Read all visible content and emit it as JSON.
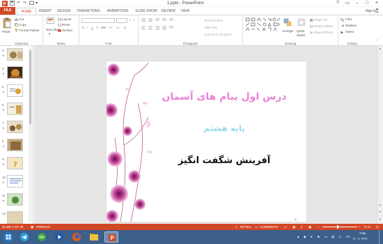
{
  "window": {
    "title": "1.pptx - PowerPoint",
    "controls": [
      "?",
      "▭",
      "–",
      "□",
      "×"
    ]
  },
  "ribbon_tabs": [
    "FILE",
    "HOME",
    "INSERT",
    "DESIGN",
    "TRANSITIONS",
    "ANIMATIONS",
    "SLIDE SHOW",
    "REVIEW",
    "VIEW"
  ],
  "active_tab": "HOME",
  "signin": "Sign in",
  "ribbon": {
    "clipboard": {
      "paste": "Paste",
      "cut": "Cut",
      "copy": "Copy",
      "format_painter": "Format Painter",
      "label": "Clipboard"
    },
    "slides": {
      "new_slide": "New Slide",
      "new_slide_line2": "▾",
      "layout": "Layout",
      "reset": "Reset",
      "section": "Section",
      "label": "Slides"
    },
    "font": {
      "label": "Font"
    },
    "paragraph": {
      "text_direction": "Text Direction",
      "align_text": "Align Text",
      "convert_smartart": "Convert to SmartArt",
      "label": "Paragraph"
    },
    "drawing": {
      "arrange": "Arrange",
      "quick_styles": "Quick",
      "quick_styles_line2": "Styles",
      "shape_fill": "Shape Fill",
      "shape_outline": "Shape Outline",
      "shape_effects": "Shape Effects",
      "label": "Drawing"
    },
    "editing": {
      "find": "Find",
      "replace": "Replace",
      "select": "Select",
      "label": "Editing"
    }
  },
  "thumbnails": [
    {
      "num": "3"
    },
    {
      "num": "4"
    },
    {
      "num": "5"
    },
    {
      "num": "6"
    },
    {
      "num": "7"
    },
    {
      "num": "8"
    },
    {
      "num": "9"
    },
    {
      "num": "10"
    },
    {
      "num": "11"
    },
    {
      "num": "12"
    }
  ],
  "slide": {
    "title": "درس اول پیام های آسمان",
    "subtitle": "پایه هشتم",
    "body": "آفرینش شگفت انگیز"
  },
  "status": {
    "slide_info": "SLIDE 2 OF 26",
    "language": "PERSIAN",
    "notes": "NOTES",
    "comments": "COMMENTS",
    "zoom": "74 %"
  },
  "taskbar": {
    "lang": "FA",
    "time": "۰۹:۵۵",
    "date": "۱۴۰۱/۰۳/۱۴"
  },
  "colors": {
    "accent": "#d24726",
    "taskbar": "#3c5f8c",
    "title_pink": "#e883d7",
    "subtitle_cyan": "#9adbe8"
  }
}
